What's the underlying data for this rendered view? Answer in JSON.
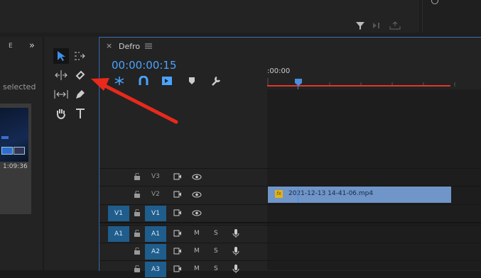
{
  "project_panel": {
    "tab_letter": "E",
    "expand_glyph": "»",
    "selected_text": "selected",
    "clip_duration": "1:09:36"
  },
  "timeline": {
    "sequence_name": "Defro",
    "close_glyph": "×",
    "timecode": "00:00:00:15",
    "ruler_start": ":00:00",
    "clip_name": "2021-12-13 14-41-06.mp4",
    "clip_fx": "fx",
    "colors": {
      "accent": "#4aa3ff",
      "playhead": "#4a8ee0",
      "work_area": "#e0362a",
      "clip": "#6f95c9"
    }
  },
  "tracks": [
    {
      "id": "v3",
      "source_label": "",
      "lock": true,
      "name": "V3",
      "type": "video",
      "name_active": false
    },
    {
      "id": "v2",
      "source_label": "",
      "lock": true,
      "name": "V2",
      "type": "video",
      "name_active": false
    },
    {
      "id": "v1",
      "source_label": "V1",
      "lock": true,
      "name": "V1",
      "type": "video",
      "name_active": true
    },
    {
      "id": "a1",
      "source_label": "A1",
      "lock": true,
      "name": "A1",
      "type": "audio",
      "name_active": true,
      "mute": "M",
      "solo": "S"
    },
    {
      "id": "a2",
      "source_label": "",
      "lock": true,
      "name": "A2",
      "type": "audio",
      "name_active": true,
      "mute": "M",
      "solo": "S"
    },
    {
      "id": "a3",
      "source_label": "",
      "lock": true,
      "name": "A3",
      "type": "audio",
      "name_active": true,
      "mute": "M",
      "solo": "S"
    }
  ],
  "icons": [
    "selection-tool-icon",
    "track-select-tool-icon",
    "ripple-edit-tool-icon",
    "razor-tool-icon",
    "slip-tool-icon",
    "pen-tool-icon",
    "hand-tool-icon",
    "type-tool-icon",
    "snap-icon",
    "linked-selection-icon",
    "add-marker-icon",
    "wrench-icon",
    "filter-icon"
  ]
}
